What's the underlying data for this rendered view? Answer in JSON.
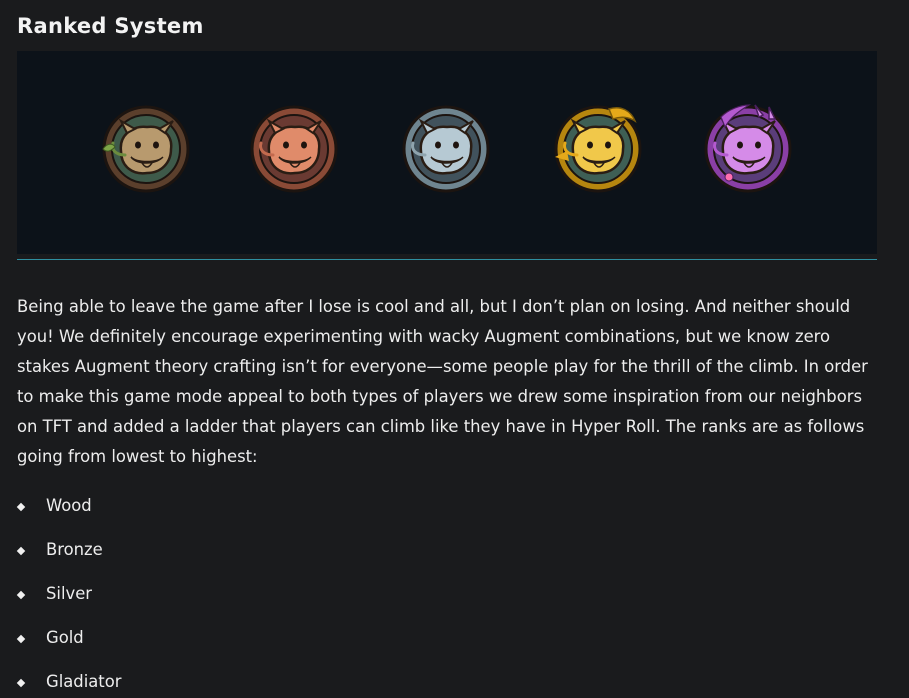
{
  "section": {
    "title": "Ranked System"
  },
  "emblems": [
    {
      "name": "wood-emblem",
      "icon": "wood-poro-emblem-icon",
      "primary": "#b89a6e",
      "rim": "#5b3f2c",
      "inner": "#3e5a4a",
      "accent": "#6b8c3e"
    },
    {
      "name": "bronze-emblem",
      "icon": "bronze-poro-emblem-icon",
      "primary": "#e08b6a",
      "rim": "#8a4a36",
      "inner": "#6a3a32",
      "accent": "#c26a4e"
    },
    {
      "name": "silver-emblem",
      "icon": "silver-poro-emblem-icon",
      "primary": "#b6c9d3",
      "rim": "#6f8590",
      "inner": "#41525c",
      "accent": "#8fa4ae"
    },
    {
      "name": "gold-emblem",
      "icon": "gold-poro-emblem-icon",
      "primary": "#f1c84a",
      "rim": "#b6860f",
      "inner": "#3e5f55",
      "accent": "#e5a91a"
    },
    {
      "name": "gladiator-emblem",
      "icon": "gladiator-poro-emblem-icon",
      "primary": "#d58be8",
      "rim": "#8a3fa6",
      "inner": "#5a3d7a",
      "accent": "#b45ad0"
    }
  ],
  "body": {
    "paragraph": "Being able to leave the game after I lose is cool and all, but I don’t plan on losing. And neither should you! We definitely encourage experimenting with wacky Augment combinations, but we know zero stakes Augment theory crafting isn’t for everyone—some people play for the thrill of the climb. In order to make this game mode appeal to both types of players we drew some inspiration from our neighbors on TFT and added a ladder that players can climb like they have in Hyper Roll. The ranks are as follows going from lowest to highest:"
  },
  "ranks": [
    "Wood",
    "Bronze",
    "Silver",
    "Gold",
    "Gladiator"
  ],
  "colors": {
    "background": "#1a1b1d",
    "banner": "#0c1219",
    "divider": "#2f8fa0",
    "text": "#ededed"
  }
}
